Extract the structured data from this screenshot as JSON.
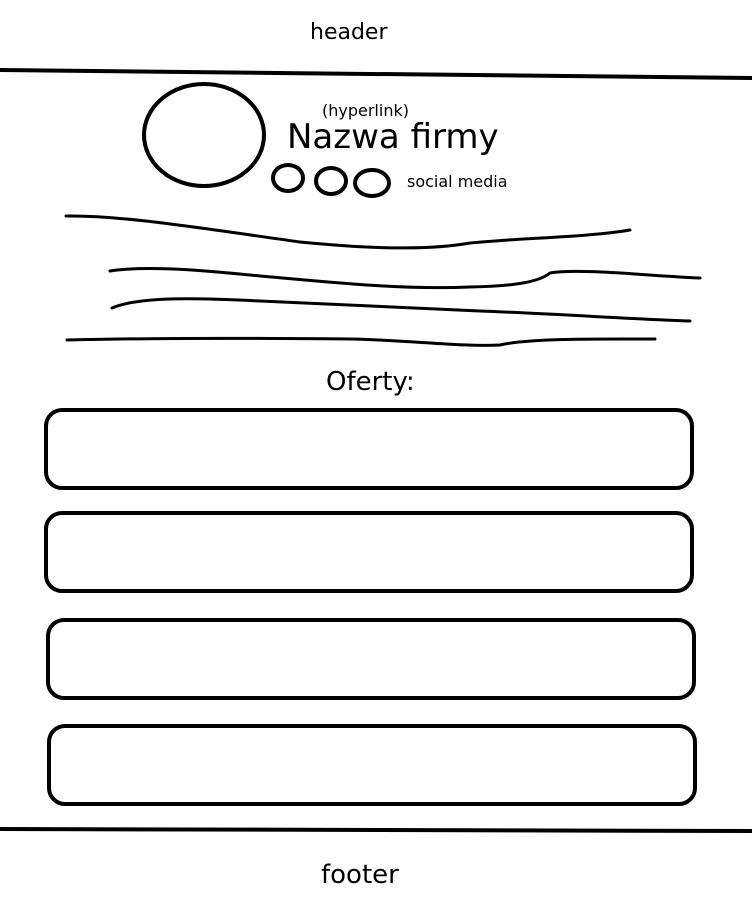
{
  "header": {
    "label": "header"
  },
  "company": {
    "hyperlink_note": "(hyperlink)",
    "name": "Nazwa firmy",
    "social_label": "social media"
  },
  "offers": {
    "heading": "Oferty:",
    "cards": [
      {
        "id": 1
      },
      {
        "id": 2
      },
      {
        "id": 3
      },
      {
        "id": 4
      }
    ]
  },
  "footer": {
    "label": "footer"
  }
}
